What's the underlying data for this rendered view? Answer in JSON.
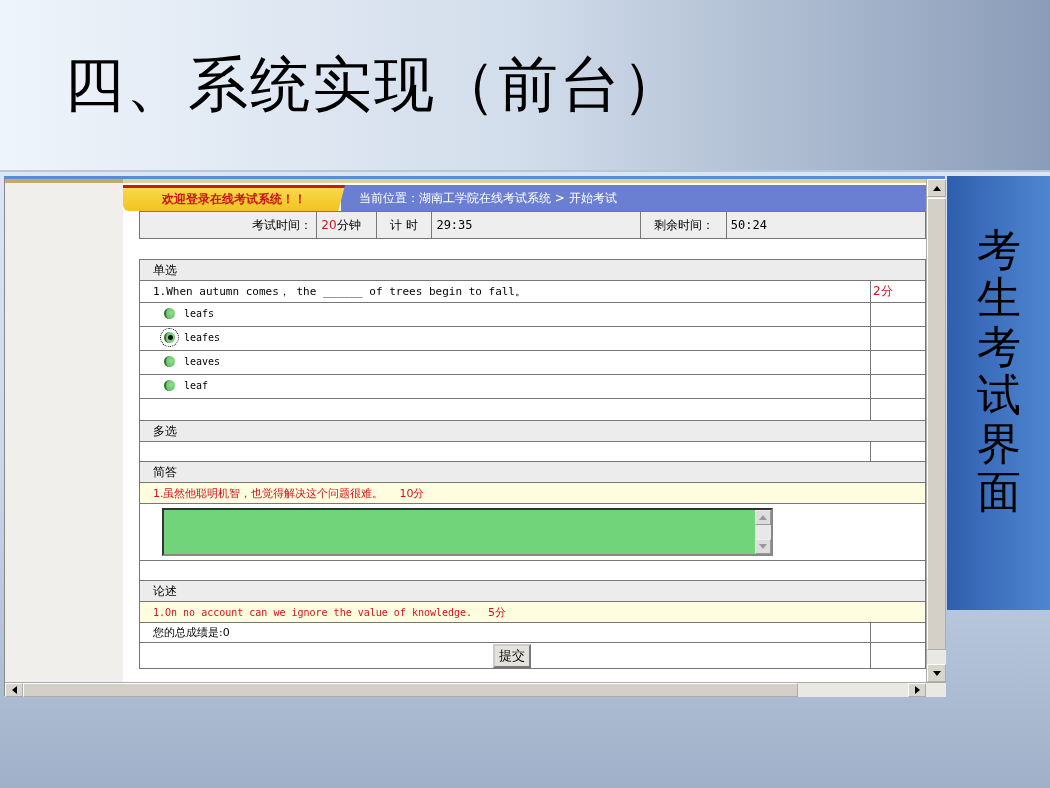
{
  "slide": {
    "title": "四、系统实现（前台）",
    "side_label": "考生考试界面"
  },
  "browser": {
    "header": {
      "welcome": "欢迎登录在线考试系统！！",
      "breadcrumb": "当前位置：湖南工学院在线考试系统 > 开始考试"
    },
    "timer": {
      "exam_time_label": "考试时间：",
      "exam_time_value": "20",
      "exam_time_unit": "分钟",
      "elapsed_label": "计 时",
      "elapsed": "29:35",
      "remaining_label": "剩余时间：",
      "remaining": "50:24"
    },
    "sections": [
      {
        "kind": "single",
        "title": "单选",
        "questions": [
          {
            "text": "1.When autumn comes， the ______ of trees begin to fall。",
            "score": "2分",
            "options": [
              {
                "label": "leafs",
                "selected": false
              },
              {
                "label": "leafes",
                "selected": true
              },
              {
                "label": "leaves",
                "selected": false
              },
              {
                "label": "leaf",
                "selected": false
              }
            ]
          }
        ]
      },
      {
        "kind": "multi",
        "title": "多选"
      },
      {
        "kind": "short",
        "title": "简答",
        "questions": [
          {
            "text": "1.虽然他聪明机智，也觉得解决这个问题很难。",
            "score": "10分"
          }
        ]
      },
      {
        "kind": "essay",
        "title": "论述",
        "questions": [
          {
            "text": "1.On no account can we ignore the value of knowledge.",
            "score": "5分"
          }
        ]
      }
    ],
    "total_score": "您的总成绩是:0",
    "submit": "提交"
  }
}
